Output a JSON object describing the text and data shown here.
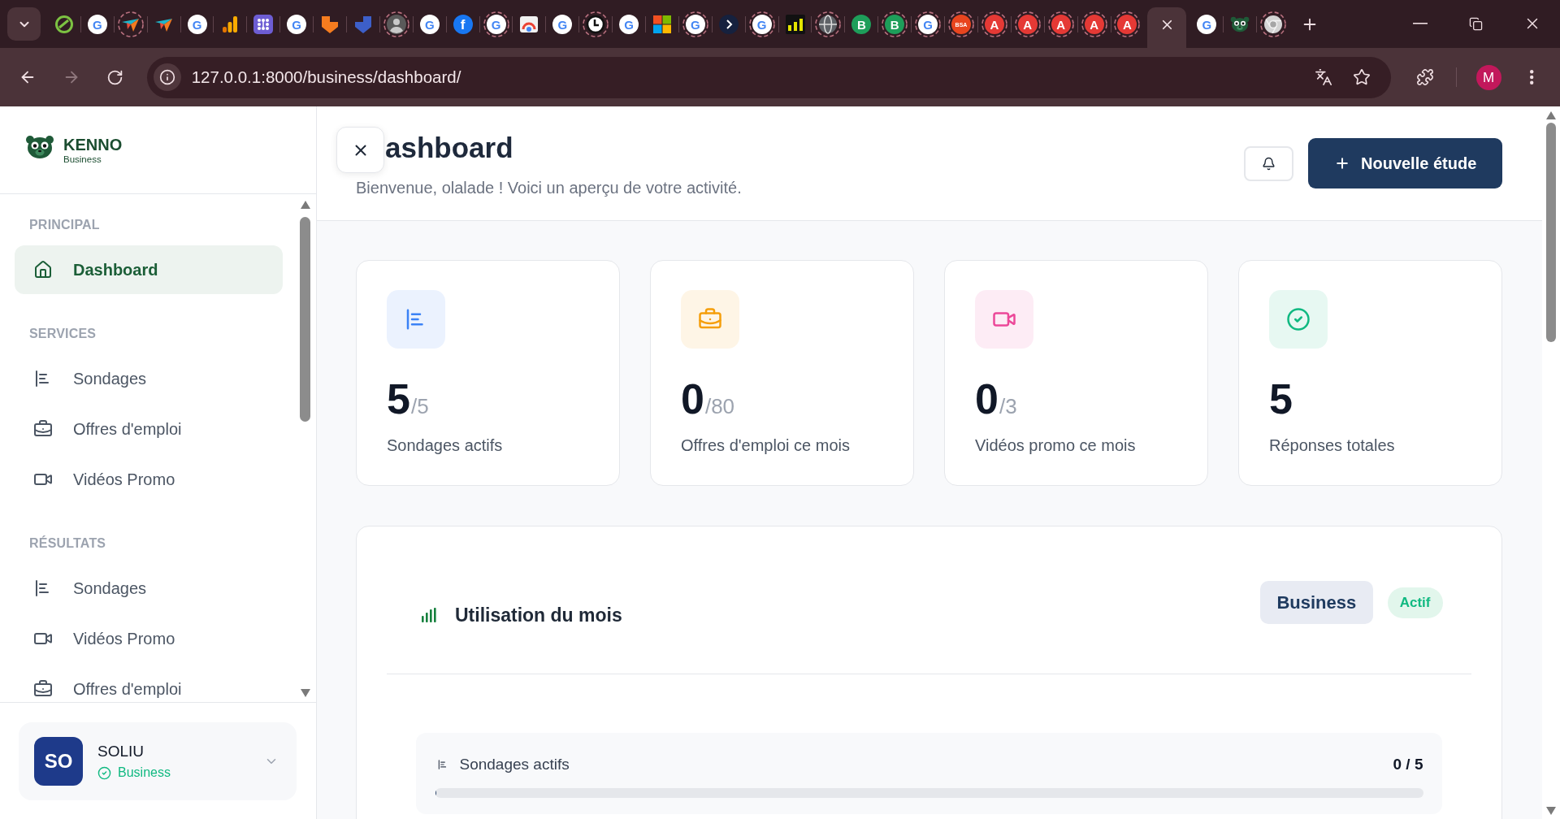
{
  "browser": {
    "tabs": [
      {
        "kind": "slashed-ring",
        "ring": false,
        "selected": false
      },
      {
        "kind": "g",
        "letter": "G",
        "ring": false,
        "selected": false
      },
      {
        "kind": "bird",
        "ring": true,
        "selected": false
      },
      {
        "kind": "bird",
        "ring": false,
        "selected": false
      },
      {
        "kind": "g",
        "letter": "G",
        "ring": false,
        "selected": false
      },
      {
        "kind": "bars",
        "ring": false,
        "selected": false
      },
      {
        "kind": "dot-grid",
        "ring": false,
        "selected": false
      },
      {
        "kind": "g",
        "letter": "G",
        "ring": false,
        "selected": false
      },
      {
        "kind": "shield-left",
        "ring": false,
        "selected": false
      },
      {
        "kind": "shield-right",
        "ring": false,
        "selected": false
      },
      {
        "kind": "avatar",
        "ring": true,
        "selected": false
      },
      {
        "kind": "g",
        "letter": "G",
        "ring": false,
        "selected": false
      },
      {
        "kind": "f",
        "letter": "f",
        "ring": false,
        "selected": false
      },
      {
        "kind": "g",
        "letter": "G",
        "ring": true,
        "selected": false
      },
      {
        "kind": "arc-tile",
        "ring": false,
        "selected": false
      },
      {
        "kind": "g",
        "letter": "G",
        "ring": false,
        "selected": false
      },
      {
        "kind": "clock",
        "ring": true,
        "selected": false
      },
      {
        "kind": "g",
        "letter": "G",
        "ring": false,
        "selected": false
      },
      {
        "kind": "squares",
        "ring": false,
        "selected": false
      },
      {
        "kind": "g",
        "letter": "G",
        "ring": true,
        "selected": false
      },
      {
        "kind": "chevron-circle",
        "ring": false,
        "selected": false
      },
      {
        "kind": "g",
        "letter": "G",
        "ring": true,
        "selected": false
      },
      {
        "kind": "yellow-bars",
        "ring": false,
        "selected": false
      },
      {
        "kind": "globe",
        "ring": true,
        "selected": false
      },
      {
        "kind": "b",
        "letter": "B",
        "ring": false,
        "selected": false
      },
      {
        "kind": "b",
        "letter": "B",
        "ring": true,
        "selected": false
      },
      {
        "kind": "g",
        "letter": "G",
        "ring": true,
        "selected": false
      },
      {
        "kind": "bsa",
        "letter": "BSA",
        "ring": true,
        "selected": false
      },
      {
        "kind": "a",
        "letter": "A",
        "ring": true,
        "selected": false
      },
      {
        "kind": "a",
        "letter": "A",
        "ring": true,
        "selected": false
      },
      {
        "kind": "a",
        "letter": "A",
        "ring": true,
        "selected": false
      },
      {
        "kind": "a",
        "letter": "A",
        "ring": true,
        "selected": false
      },
      {
        "kind": "a",
        "letter": "A",
        "ring": true,
        "selected": false
      },
      {
        "selected": true
      },
      {
        "kind": "g",
        "letter": "G",
        "ring": false,
        "selected": false
      },
      {
        "kind": "bear",
        "ring": false,
        "selected": false
      },
      {
        "kind": "aperture",
        "ring": true,
        "selected": false
      }
    ],
    "back_disabled": false,
    "forward_disabled": true,
    "address": "127.0.0.1:8000/business/dashboard/",
    "profile_initial": "M"
  },
  "sidebar": {
    "brand": {
      "name": "KENNO",
      "tagline": "Business"
    },
    "sections": [
      {
        "title": "PRINCIPAL",
        "items": [
          {
            "label": "Dashboard",
            "kind": "home",
            "selected": true
          }
        ]
      },
      {
        "title": "SERVICES",
        "items": [
          {
            "label": "Sondages",
            "kind": "surveys",
            "selected": false
          },
          {
            "label": "Offres d'emploi",
            "kind": "jobs",
            "selected": false
          },
          {
            "label": "Vidéos Promo",
            "kind": "videos",
            "selected": false
          }
        ]
      },
      {
        "title": "RÉSULTATS",
        "items": [
          {
            "label": "Sondages",
            "kind": "surveys",
            "selected": false
          },
          {
            "label": "Vidéos Promo",
            "kind": "videos",
            "selected": false
          },
          {
            "label": "Offres d'emploi",
            "kind": "jobs",
            "selected": false
          }
        ]
      }
    ],
    "user": {
      "initials": "SO",
      "name": "SOLIU",
      "plan": "Business"
    }
  },
  "header": {
    "title": "ashboard",
    "subtitle": "Bienvenue, olalade ! Voici un aperçu de votre activité.",
    "action": "Nouvelle étude"
  },
  "stats": [
    {
      "kind": "surveys",
      "color": "#3b82f6",
      "value": "5",
      "limit": "/5",
      "label": "Sondages actifs"
    },
    {
      "kind": "jobs",
      "color": "#f59e0b",
      "value": "0",
      "limit": "/80",
      "label": "Offres d'emploi ce mois"
    },
    {
      "kind": "videos",
      "color": "#ec4899",
      "value": "0",
      "limit": "/3",
      "label": "Vidéos promo ce mois"
    },
    {
      "kind": "responses",
      "color": "#10b981",
      "value": "5",
      "label": "Réponses totales"
    }
  ],
  "usage": {
    "title": "Utilisation du mois",
    "plan": "Business",
    "status": "Actif",
    "meters": [
      {
        "kind": "surveys",
        "label": "Sondages actifs",
        "reading": "0 / 5",
        "level": 0
      }
    ]
  }
}
